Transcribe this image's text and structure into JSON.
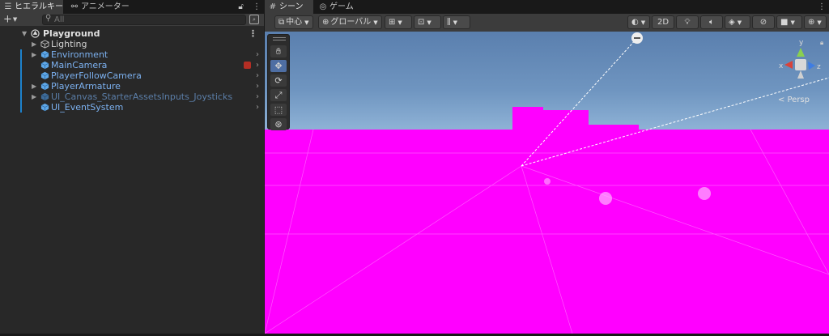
{
  "hierarchy": {
    "tab_label": "ヒエラルキー",
    "tab2_label": "アニメーター",
    "lock_icon": "lock-icon",
    "search_placeholder": "All",
    "add_label": "+",
    "root": "Playground",
    "items": [
      {
        "label": "Lighting"
      },
      {
        "label": "Environment"
      },
      {
        "label": "MainCamera"
      },
      {
        "label": "PlayerFollowCamera"
      },
      {
        "label": "PlayerArmature"
      },
      {
        "label": "UI_Canvas_StarterAssetsInputs_Joysticks"
      },
      {
        "label": "UI_EventSystem"
      }
    ]
  },
  "scene": {
    "tab_label": "シーン",
    "tab2_label": "ゲーム",
    "toolbar": {
      "pivot_label": "中心",
      "space_label": "グローバル",
      "mode_2d": "2D"
    },
    "gizmo": {
      "y": "y",
      "x": "x",
      "z": "z",
      "persp_label": "< Persp"
    }
  },
  "colors": {
    "ground": "#ff00ff",
    "accent": "#4e6ea3",
    "prefab_text": "#7cb1f0"
  }
}
